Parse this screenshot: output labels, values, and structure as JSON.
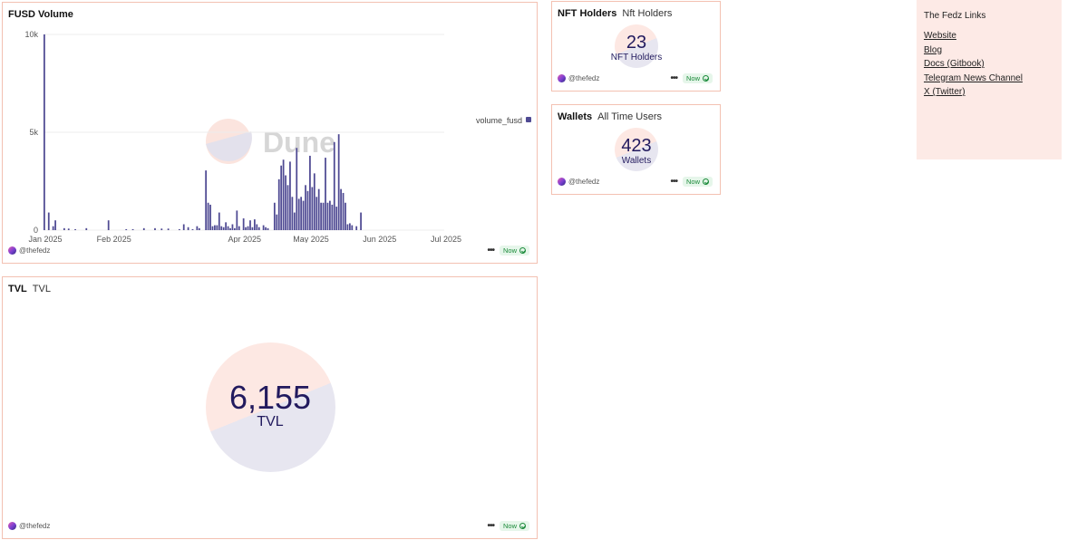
{
  "colors": {
    "card_border": "#f3c1b2",
    "bar": "#4f4a93",
    "counter_text": "#221a5e",
    "links_bg": "#fdeae6",
    "badge_bg": "#e6f6ea",
    "badge_text": "#1b8a3a"
  },
  "fusd_card": {
    "title": "FUSD Volume",
    "author": "@thefedz",
    "status": "Now",
    "watermark": "Dune"
  },
  "chart_data": {
    "type": "bar",
    "title": "FUSD Volume",
    "series": [
      {
        "name": "volume_fusd"
      }
    ],
    "legend_position": "right",
    "ylim": [
      0,
      10000
    ],
    "yticks": [
      0,
      5000,
      10000
    ],
    "ytick_labels": [
      "0",
      "5k",
      "10k"
    ],
    "x_start": "2025-01-01",
    "x_end": "2025-07-01",
    "xtick_labels": [
      {
        "date": "2025-01-01",
        "label": "Jan 2025"
      },
      {
        "date": "2025-02-01",
        "label": "Feb 2025"
      },
      {
        "date": "2025-04-01",
        "label": "Apr 2025"
      },
      {
        "date": "2025-05-01",
        "label": "May 2025"
      },
      {
        "date": "2025-06-01",
        "label": "Jun 2025"
      },
      {
        "date": "2025-07-01",
        "label": "Jul 2025"
      }
    ],
    "grid": true,
    "points": [
      {
        "date": "2025-01-01",
        "value": 10000
      },
      {
        "date": "2025-01-03",
        "value": 900
      },
      {
        "date": "2025-01-05",
        "value": 200
      },
      {
        "date": "2025-01-06",
        "value": 500
      },
      {
        "date": "2025-01-10",
        "value": 100
      },
      {
        "date": "2025-01-12",
        "value": 80
      },
      {
        "date": "2025-01-15",
        "value": 50
      },
      {
        "date": "2025-01-20",
        "value": 100
      },
      {
        "date": "2025-01-30",
        "value": 500
      },
      {
        "date": "2025-02-07",
        "value": 50
      },
      {
        "date": "2025-02-10",
        "value": 50
      },
      {
        "date": "2025-02-15",
        "value": 100
      },
      {
        "date": "2025-02-20",
        "value": 100
      },
      {
        "date": "2025-02-23",
        "value": 80
      },
      {
        "date": "2025-02-26",
        "value": 80
      },
      {
        "date": "2025-03-03",
        "value": 50
      },
      {
        "date": "2025-03-05",
        "value": 300
      },
      {
        "date": "2025-03-07",
        "value": 150
      },
      {
        "date": "2025-03-09",
        "value": 50
      },
      {
        "date": "2025-03-11",
        "value": 200
      },
      {
        "date": "2025-03-12",
        "value": 100
      },
      {
        "date": "2025-03-15",
        "value": 3050
      },
      {
        "date": "2025-03-16",
        "value": 1400
      },
      {
        "date": "2025-03-17",
        "value": 1300
      },
      {
        "date": "2025-03-18",
        "value": 200
      },
      {
        "date": "2025-03-19",
        "value": 250
      },
      {
        "date": "2025-03-20",
        "value": 250
      },
      {
        "date": "2025-03-21",
        "value": 900
      },
      {
        "date": "2025-03-22",
        "value": 200
      },
      {
        "date": "2025-03-23",
        "value": 150
      },
      {
        "date": "2025-03-24",
        "value": 400
      },
      {
        "date": "2025-03-25",
        "value": 200
      },
      {
        "date": "2025-03-26",
        "value": 100
      },
      {
        "date": "2025-03-27",
        "value": 300
      },
      {
        "date": "2025-03-28",
        "value": 100
      },
      {
        "date": "2025-03-29",
        "value": 1000
      },
      {
        "date": "2025-03-30",
        "value": 200
      },
      {
        "date": "2025-04-01",
        "value": 600
      },
      {
        "date": "2025-04-02",
        "value": 150
      },
      {
        "date": "2025-04-03",
        "value": 200
      },
      {
        "date": "2025-04-04",
        "value": 500
      },
      {
        "date": "2025-04-05",
        "value": 150
      },
      {
        "date": "2025-04-06",
        "value": 550
      },
      {
        "date": "2025-04-07",
        "value": 300
      },
      {
        "date": "2025-04-08",
        "value": 150
      },
      {
        "date": "2025-04-10",
        "value": 250
      },
      {
        "date": "2025-04-11",
        "value": 150
      },
      {
        "date": "2025-04-12",
        "value": 100
      },
      {
        "date": "2025-04-15",
        "value": 1400
      },
      {
        "date": "2025-04-16",
        "value": 800
      },
      {
        "date": "2025-04-17",
        "value": 2600
      },
      {
        "date": "2025-04-18",
        "value": 3300
      },
      {
        "date": "2025-04-19",
        "value": 3600
      },
      {
        "date": "2025-04-20",
        "value": 2800
      },
      {
        "date": "2025-04-21",
        "value": 2300
      },
      {
        "date": "2025-04-22",
        "value": 3500
      },
      {
        "date": "2025-04-23",
        "value": 1700
      },
      {
        "date": "2025-04-24",
        "value": 900
      },
      {
        "date": "2025-04-25",
        "value": 4200
      },
      {
        "date": "2025-04-26",
        "value": 1600
      },
      {
        "date": "2025-04-27",
        "value": 1700
      },
      {
        "date": "2025-04-28",
        "value": 1500
      },
      {
        "date": "2025-04-29",
        "value": 2300
      },
      {
        "date": "2025-04-30",
        "value": 2000
      },
      {
        "date": "2025-05-01",
        "value": 3800
      },
      {
        "date": "2025-05-02",
        "value": 2200
      },
      {
        "date": "2025-05-03",
        "value": 2900
      },
      {
        "date": "2025-05-04",
        "value": 1700
      },
      {
        "date": "2025-05-05",
        "value": 2100
      },
      {
        "date": "2025-05-06",
        "value": 1400
      },
      {
        "date": "2025-05-07",
        "value": 1400
      },
      {
        "date": "2025-05-08",
        "value": 3700
      },
      {
        "date": "2025-05-09",
        "value": 1400
      },
      {
        "date": "2025-05-10",
        "value": 1500
      },
      {
        "date": "2025-05-11",
        "value": 1300
      },
      {
        "date": "2025-05-12",
        "value": 4500
      },
      {
        "date": "2025-05-13",
        "value": 1200
      },
      {
        "date": "2025-05-14",
        "value": 4900
      },
      {
        "date": "2025-05-15",
        "value": 2100
      },
      {
        "date": "2025-05-16",
        "value": 1900
      },
      {
        "date": "2025-05-17",
        "value": 1400
      },
      {
        "date": "2025-05-18",
        "value": 300
      },
      {
        "date": "2025-05-19",
        "value": 350
      },
      {
        "date": "2025-05-20",
        "value": 250
      },
      {
        "date": "2025-05-22",
        "value": 200
      },
      {
        "date": "2025-05-24",
        "value": 900
      }
    ]
  },
  "tvl_card": {
    "title": "TVL",
    "subtitle": "TVL",
    "value": "6,155",
    "label": "TVL",
    "author": "@thefedz",
    "status": "Now"
  },
  "nft_card": {
    "title": "NFT Holders",
    "subtitle": "Nft Holders",
    "value": "23",
    "label": "NFT Holders",
    "author": "@thefedz",
    "status": "Now"
  },
  "wallets_card": {
    "title": "Wallets",
    "subtitle": "All Time Users",
    "value": "423",
    "label": "Wallets",
    "author": "@thefedz",
    "status": "Now"
  },
  "links_panel": {
    "title": "The Fedz Links",
    "items": [
      {
        "label": "Website"
      },
      {
        "label": "Blog"
      },
      {
        "label": "Docs (Gitbook)"
      },
      {
        "label": "Telegram News Channel"
      },
      {
        "label": "X (Twitter)"
      }
    ]
  }
}
